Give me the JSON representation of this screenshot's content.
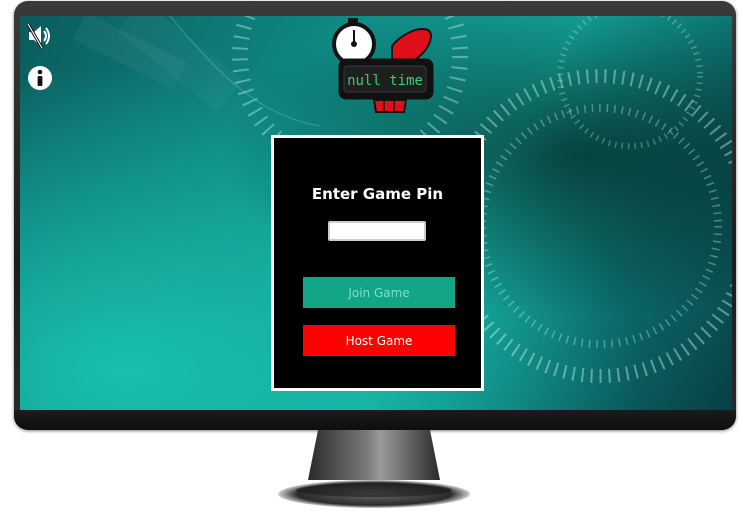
{
  "logo": {
    "text": "null time"
  },
  "dialog": {
    "title": "Enter Game Pin",
    "pin_input": {
      "value": "",
      "placeholder": ""
    },
    "join_label": "Join Game",
    "host_label": "Host Game"
  },
  "toolbar": {
    "mute_icon": "speaker-muted-icon",
    "info_icon": "info-icon"
  },
  "colors": {
    "join_button": "#12a586",
    "host_button": "#ff0000",
    "dialog_bg": "#000000",
    "dialog_border": "#ffffff",
    "logo_accent": "#e0101a",
    "logo_text": "#2bd46a"
  }
}
